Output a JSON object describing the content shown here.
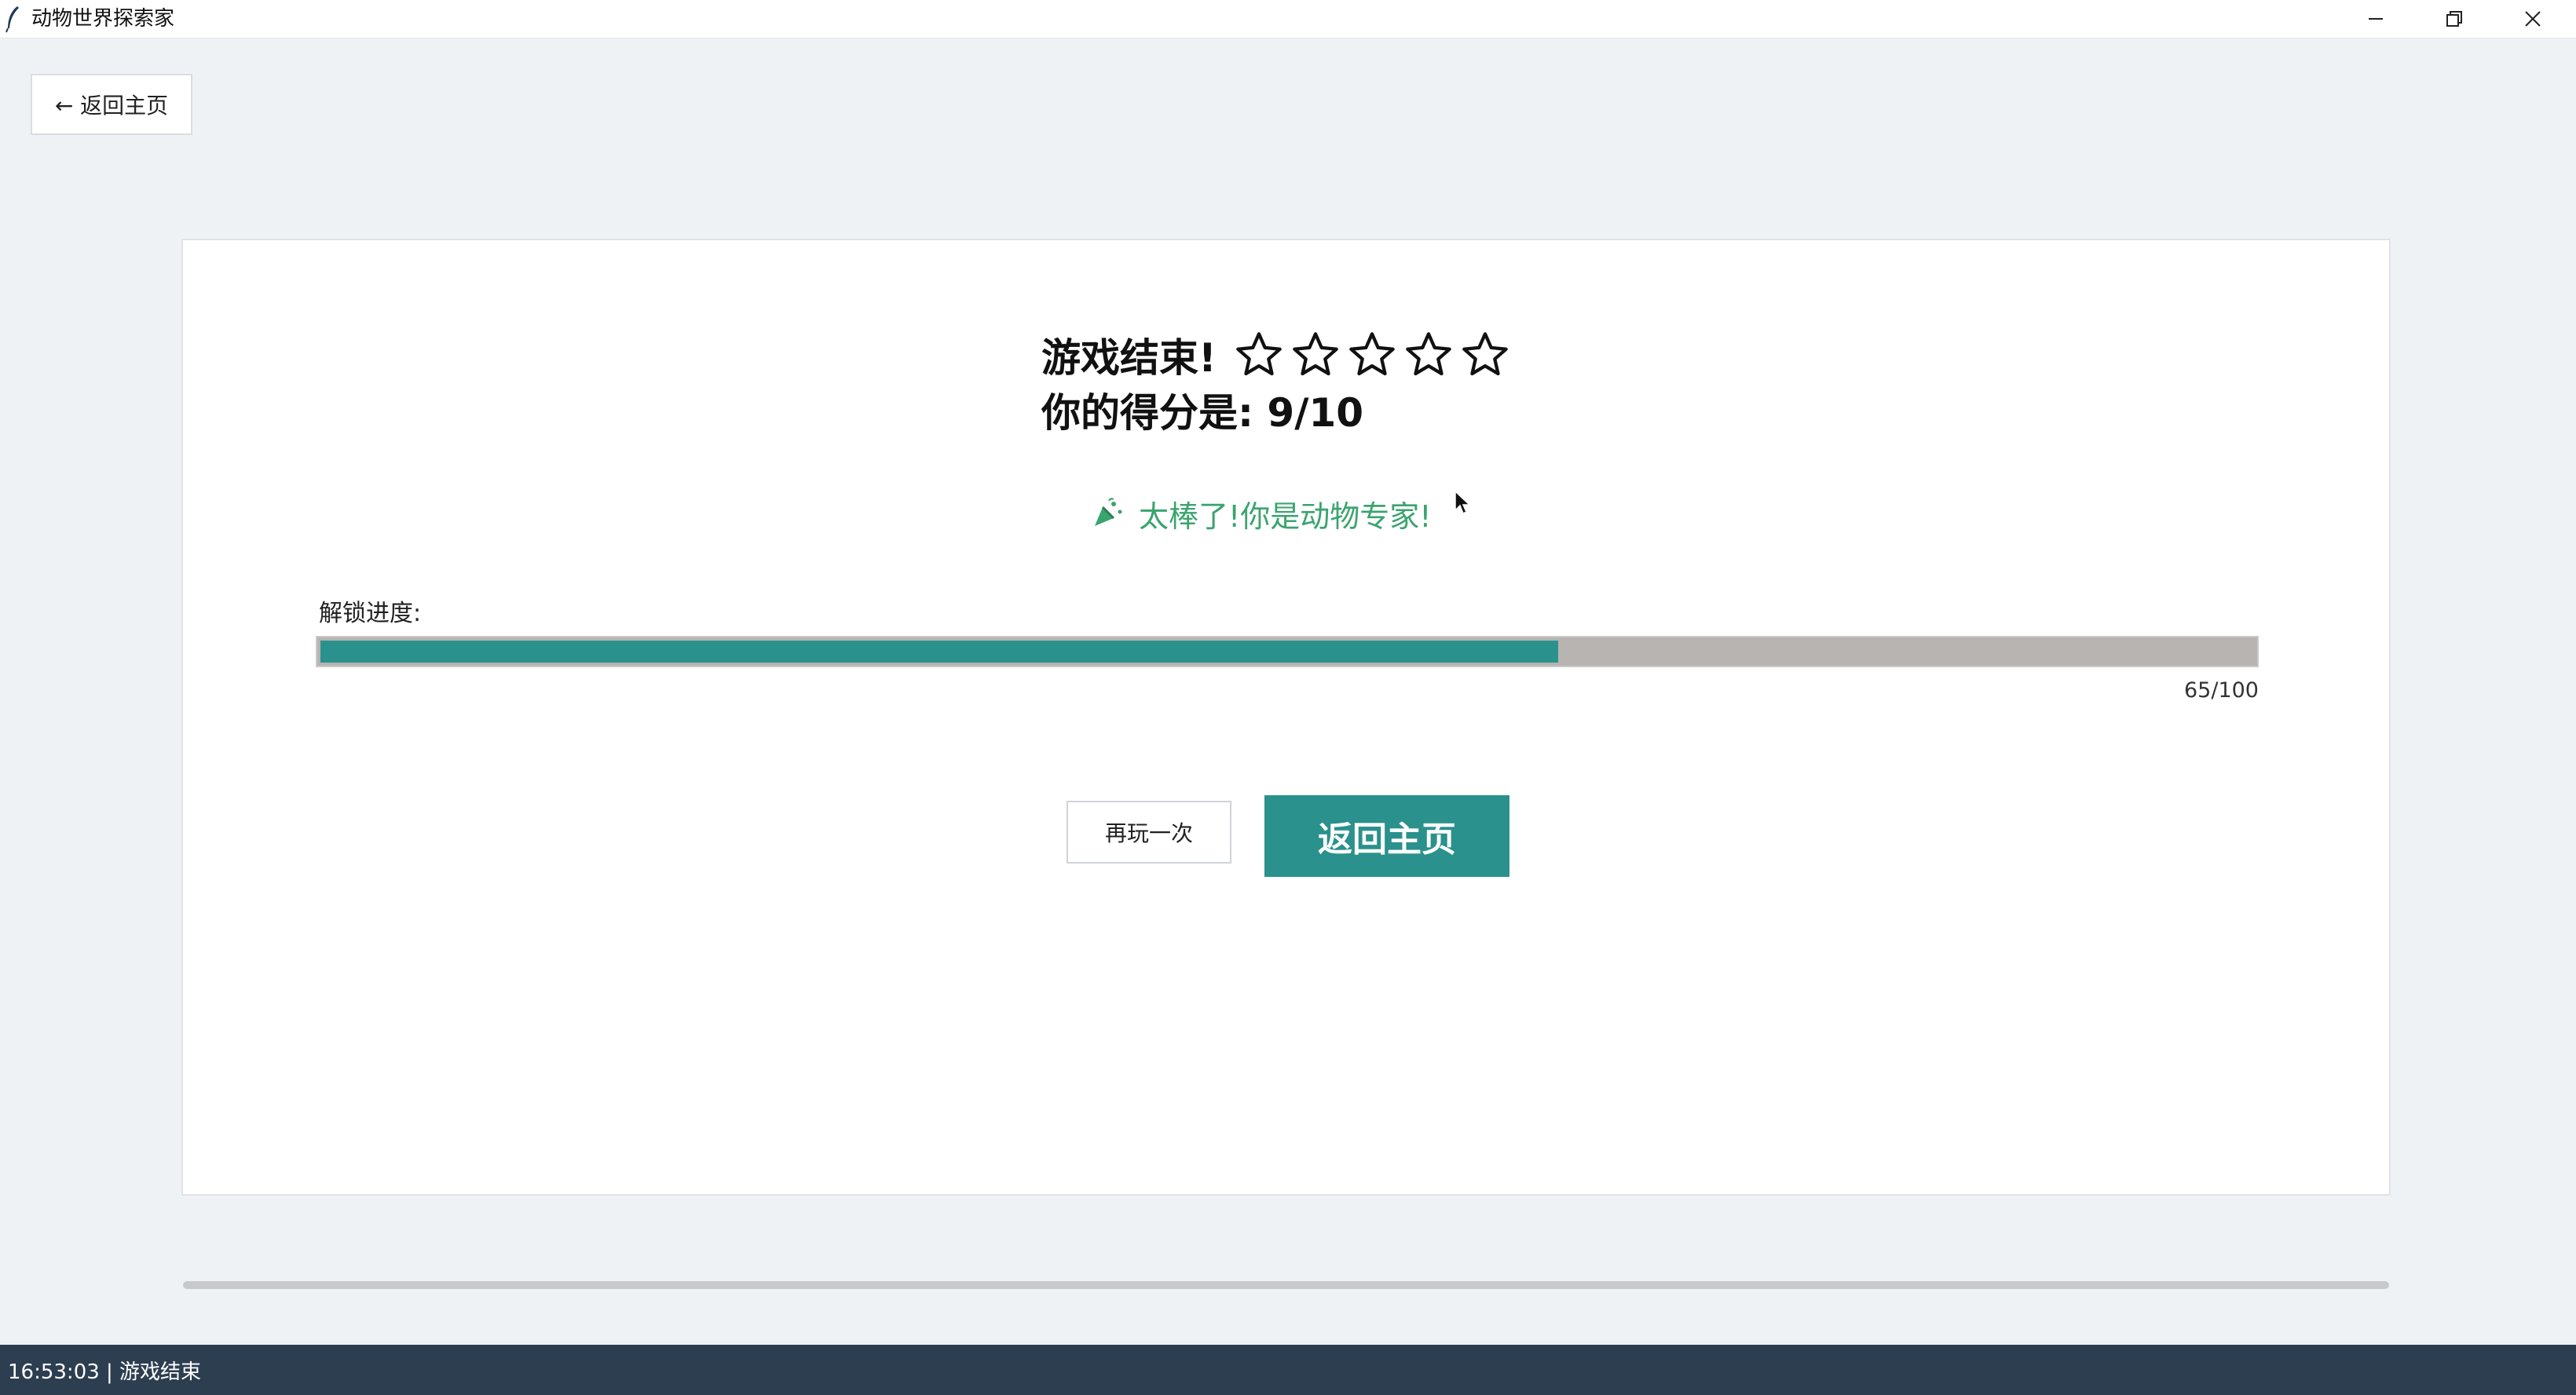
{
  "window": {
    "title": "动物世界探索家",
    "minimize_glyph": "–",
    "maximize_glyph": "❐",
    "close_glyph": "✕"
  },
  "back_button": {
    "label": "← 返回主页"
  },
  "result": {
    "title": "游戏结束!",
    "stars_total": 5,
    "stars_filled": 0,
    "score_text": "你的得分是: 9/10",
    "praise": "太棒了!你是动物专家!"
  },
  "progress": {
    "label": "解锁进度:",
    "value": 65,
    "max": 100,
    "text": "65/100"
  },
  "buttons": {
    "replay": "再玩一次",
    "home": "返回主页"
  },
  "status": {
    "text": "16:53:03 | 游戏结束"
  },
  "colors": {
    "accent": "#2a918c",
    "praise": "#3aa46e",
    "statusbar": "#2c3e50"
  },
  "icons": {
    "app": "feather-icon",
    "star": "star-outline-icon",
    "praise": "party-popper-icon"
  }
}
